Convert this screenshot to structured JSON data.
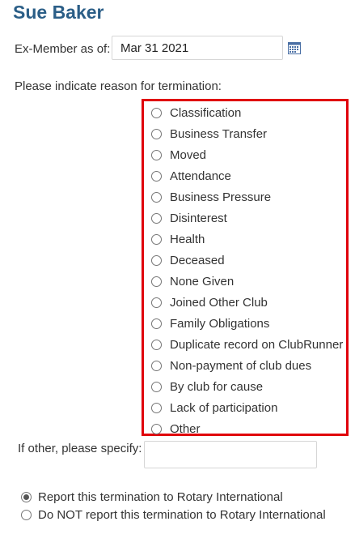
{
  "member": {
    "name": "Sue Baker"
  },
  "exmember": {
    "label": "Ex-Member as of:",
    "date_value": "Mar 31 2021",
    "calendar_icon": "calendar-icon"
  },
  "termination": {
    "prompt": "Please indicate reason for termination:",
    "reasons": [
      "Classification",
      "Business Transfer",
      "Moved",
      "Attendance",
      "Business Pressure",
      "Disinterest",
      "Health",
      "Deceased",
      "None Given",
      "Joined Other Club",
      "Family Obligations",
      "Duplicate record on ClubRunner",
      "Non-payment of club dues",
      "By club for cause",
      "Lack of participation",
      "Other"
    ],
    "highlight_color": "#e0000b"
  },
  "other": {
    "label": "If other, please specify:",
    "value": ""
  },
  "report": {
    "options": [
      {
        "label": "Report this termination to Rotary International",
        "checked": true
      },
      {
        "label": "Do NOT report this termination to Rotary International",
        "checked": false
      }
    ]
  },
  "colors": {
    "title": "#2b5e87",
    "text": "#333333"
  }
}
